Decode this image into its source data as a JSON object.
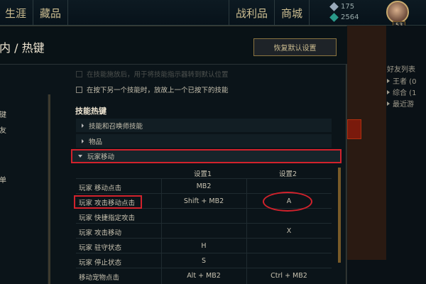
{
  "topbar": {
    "nav_left": [
      "生涯",
      "藏品"
    ],
    "nav_right": [
      "战利品",
      "商城"
    ],
    "currency": [
      {
        "icon": "blue-essence-icon",
        "value": "175",
        "color": "#9ab"
      },
      {
        "icon": "orange-essence-icon",
        "value": "2564",
        "color": "#2a9a8a"
      }
    ],
    "level": "53"
  },
  "modal": {
    "title": "内 / 热键",
    "reset_button": "恢复默认设置",
    "left_nav": [
      "键",
      "友",
      "单"
    ],
    "check_faded": "在技能施放后，用于将技能指示器转到默认位置",
    "check_option": "在按下另一个技能时，放故上一个已按下的技能",
    "section_title": "技能热键",
    "categories": [
      {
        "label": "技能和召唤师技能",
        "open": false
      },
      {
        "label": "物品",
        "open": false
      },
      {
        "label": "玩家移动",
        "open": true
      }
    ],
    "table": {
      "headers": [
        "设置1",
        "设置2"
      ],
      "rows": [
        {
          "name": "玩家 移动点击",
          "v1": "MB2",
          "v2": ""
        },
        {
          "name": "玩家 攻击移动点击",
          "v1": "Shift + MB2",
          "v2": "A"
        },
        {
          "name": "玩家 快捷指定攻击",
          "v1": "",
          "v2": ""
        },
        {
          "name": "玩家 攻击移动",
          "v1": "",
          "v2": "X"
        },
        {
          "name": "玩家 驻守状态",
          "v1": "H",
          "v2": ""
        },
        {
          "name": "玩家 停止状态",
          "v1": "S",
          "v2": ""
        },
        {
          "name": "移动宠物点击",
          "v1": "Alt + MB2",
          "v2": "Ctrl + MB2"
        }
      ]
    }
  },
  "friends": {
    "header": "好友列表",
    "groups": [
      "王者 (0",
      "综合 (1",
      "最近游"
    ]
  },
  "colors": {
    "accent_gold": "#cdbe91",
    "highlight_red": "#d2222c"
  }
}
